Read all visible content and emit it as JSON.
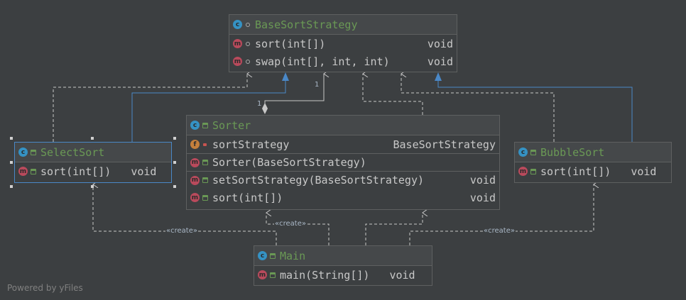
{
  "classes": {
    "base": {
      "name": "BaseSortStrategy",
      "methods": [
        {
          "name": "sort(int[])",
          "type": "void"
        },
        {
          "name": "swap(int[], int, int)",
          "type": "void"
        }
      ]
    },
    "sorter": {
      "name": "Sorter",
      "fields": [
        {
          "name": "sortStrategy",
          "type": "BaseSortStrategy"
        }
      ],
      "constructors": [
        {
          "name": "Sorter(BaseSortStrategy)"
        }
      ],
      "methods": [
        {
          "name": "setSortStrategy(BaseSortStrategy)",
          "type": "void"
        },
        {
          "name": "sort(int[])",
          "type": "void"
        }
      ]
    },
    "select": {
      "name": "SelectSort",
      "methods": [
        {
          "name": "sort(int[])",
          "type": "void"
        }
      ]
    },
    "bubble": {
      "name": "BubbleSort",
      "methods": [
        {
          "name": "sort(int[])",
          "type": "void"
        }
      ]
    },
    "main": {
      "name": "Main",
      "methods": [
        {
          "name": "main(String[])",
          "type": "void"
        }
      ]
    }
  },
  "edge_labels": {
    "multiplicity_a": "1",
    "multiplicity_b": "1",
    "create_left": "«create»",
    "create_center": "«create»",
    "create_right": "«create»"
  },
  "badges": {
    "class": "c",
    "method": "m",
    "field": "f"
  },
  "colors": {
    "background": "#3c3f41",
    "class_name": "#6a9955",
    "selection_border": "#4a88c7",
    "inheritance_edge": "#4a88c7",
    "dependency_edge": "#c8c8c8"
  },
  "footer": "Powered by yFiles"
}
